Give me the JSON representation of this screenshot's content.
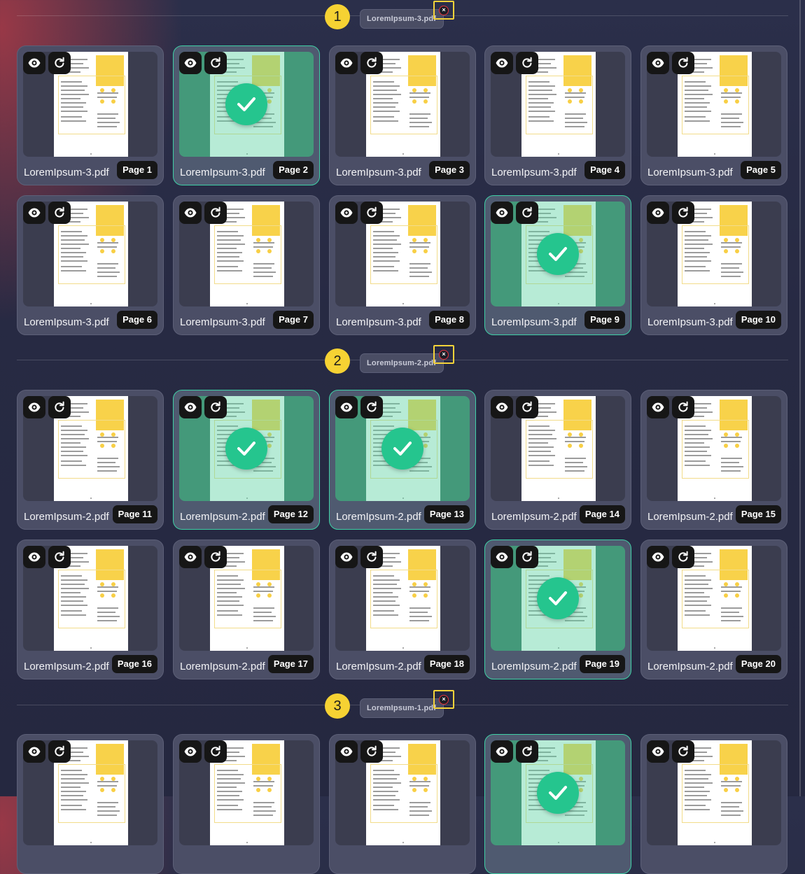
{
  "groups": [
    {
      "number": "1",
      "file": "LoremIpsum-3.pdf",
      "close_label": "×",
      "cards": [
        {
          "page": "Page 1",
          "file": "LoremIpsum-3.pdf",
          "selected": false
        },
        {
          "page": "Page 2",
          "file": "LoremIpsum-3.pdf",
          "selected": true
        },
        {
          "page": "Page 3",
          "file": "LoremIpsum-3.pdf",
          "selected": false
        },
        {
          "page": "Page 4",
          "file": "LoremIpsum-3.pdf",
          "selected": false
        },
        {
          "page": "Page 5",
          "file": "LoremIpsum-3.pdf",
          "selected": false
        },
        {
          "page": "Page 6",
          "file": "LoremIpsum-3.pdf",
          "selected": false
        },
        {
          "page": "Page 7",
          "file": "LoremIpsum-3.pdf",
          "selected": false
        },
        {
          "page": "Page 8",
          "file": "LoremIpsum-3.pdf",
          "selected": false
        },
        {
          "page": "Page 9",
          "file": "LoremIpsum-3.pdf",
          "selected": true
        },
        {
          "page": "Page 10",
          "file": "LoremIpsum-3.pdf",
          "selected": false
        }
      ]
    },
    {
      "number": "2",
      "file": "LoremIpsum-2.pdf",
      "close_label": "×",
      "cards": [
        {
          "page": "Page 11",
          "file": "LoremIpsum-2.pdf",
          "selected": false
        },
        {
          "page": "Page 12",
          "file": "LoremIpsum-2.pdf",
          "selected": true
        },
        {
          "page": "Page 13",
          "file": "LoremIpsum-2.pdf",
          "selected": true
        },
        {
          "page": "Page 14",
          "file": "LoremIpsum-2.pdf",
          "selected": false
        },
        {
          "page": "Page 15",
          "file": "LoremIpsum-2.pdf",
          "selected": false
        },
        {
          "page": "Page 16",
          "file": "LoremIpsum-2.pdf",
          "selected": false
        },
        {
          "page": "Page 17",
          "file": "LoremIpsum-2.pdf",
          "selected": false
        },
        {
          "page": "Page 18",
          "file": "LoremIpsum-2.pdf",
          "selected": false
        },
        {
          "page": "Page 19",
          "file": "LoremIpsum-2.pdf",
          "selected": true
        },
        {
          "page": "Page 20",
          "file": "LoremIpsum-2.pdf",
          "selected": false
        }
      ]
    },
    {
      "number": "3",
      "file": "LoremIpsum-1.pdf",
      "close_label": "×",
      "cards": [
        {
          "page": "",
          "file": "",
          "selected": false
        },
        {
          "page": "",
          "file": "",
          "selected": false
        },
        {
          "page": "",
          "file": "",
          "selected": false
        },
        {
          "page": "",
          "file": "",
          "selected": true
        },
        {
          "page": "",
          "file": "",
          "selected": false
        }
      ]
    }
  ],
  "icons": {
    "preview": "eye-icon",
    "rotate": "rotate-icon",
    "remove": "close-icon",
    "selected": "check-icon"
  },
  "colors": {
    "accent": "#3fd0a6",
    "highlight": "#f6d233",
    "check": "#25c58e",
    "remove_ring": "#e2333a"
  }
}
